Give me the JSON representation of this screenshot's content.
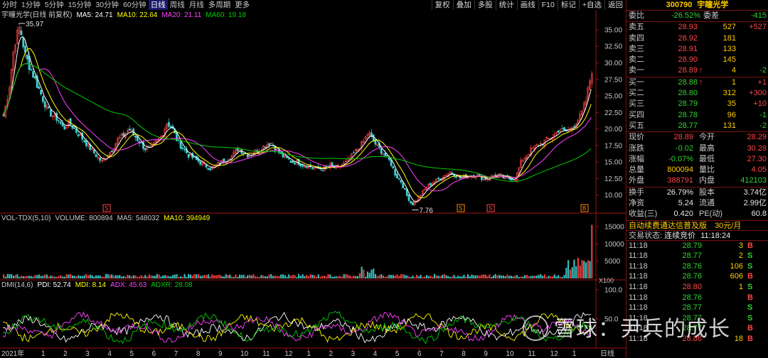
{
  "toolbar": {
    "periods": [
      "分时",
      "1分钟",
      "5分钟",
      "15分钟",
      "30分钟",
      "60分钟",
      "日线",
      "周线",
      "月线",
      "多周期",
      "更多"
    ],
    "active_period": "日线",
    "buttons": [
      "复权",
      "叠加",
      "多股",
      "统计",
      "画线",
      "F10",
      "标记",
      "+自选",
      "返回"
    ]
  },
  "main_legend": {
    "title": "宇瞳光学(日线 前复权)",
    "ma5": "MA5: 24.71",
    "ma10": "MA10: 22.64",
    "ma20": "MA20: 21.11",
    "ma60": "MA60: 19.18"
  },
  "vol_legend": {
    "title": "VOL-TDX(5,10)",
    "volume": "VOLUME: 800894",
    "ma5": "MA5: 548032",
    "ma10": "MA10: 394949",
    "unit": "X100"
  },
  "dmi_legend": {
    "title": "DMI(14,6)",
    "pdi": "PDI: 52.74",
    "mdi": "MDI: 8.14",
    "adx": "ADX: 45.63",
    "adxr": "ADXR: 28.08"
  },
  "annotations": {
    "high": "35.97",
    "low": "7.76",
    "markers": [
      "S",
      "S",
      "S",
      "B"
    ]
  },
  "x_axis": {
    "year_label": "2021年",
    "month_labels": [
      "1",
      "2",
      "3",
      "4",
      "5",
      "6",
      "7",
      "8",
      "9",
      "10",
      "11",
      "12",
      "1",
      "2",
      "3",
      "4",
      "5",
      "6",
      "7",
      "8",
      "9",
      "10",
      "11",
      "12",
      "1"
    ],
    "tail_label": "日线"
  },
  "colors": {
    "up": "#ff4545",
    "down": "#40d0d0",
    "ma5": "#ffffff",
    "ma10": "#ffff00",
    "ma20": "#ff40ff",
    "ma60": "#00cc00",
    "axis": "#a01010"
  },
  "chart_data": [
    {
      "type": "line",
      "name": "price",
      "ylim": [
        7.5,
        36.5
      ],
      "yticks": [
        "10.00",
        "12.50",
        "15.00",
        "17.50",
        "20.00",
        "22.50",
        "25.00",
        "27.50",
        "30.00",
        "32.50",
        "35.00"
      ],
      "ytick_values": [
        10,
        12.5,
        15,
        17.5,
        20,
        22.5,
        25,
        27.5,
        30,
        32.5,
        35
      ],
      "close": [
        22,
        26,
        33,
        35.5,
        31,
        29,
        27,
        25,
        23,
        22,
        21.5,
        20,
        21,
        20,
        19,
        18,
        17,
        16,
        15,
        16,
        17,
        18.5,
        19,
        20,
        19,
        18,
        17,
        17,
        18,
        19,
        21,
        20,
        18,
        17,
        16,
        15.5,
        15,
        14.5,
        14,
        14.5,
        15,
        15.5,
        16,
        17,
        16.5,
        16,
        16.5,
        17,
        17.5,
        18,
        17,
        16,
        15.5,
        15,
        15,
        14.5,
        14.5,
        14,
        14,
        14,
        14.5,
        14,
        14.5,
        15,
        16,
        17,
        18,
        19.5,
        18,
        17,
        16,
        15,
        13,
        12,
        10,
        8.5,
        9.5,
        10.5,
        11.5,
        12,
        12.5,
        13,
        13.5,
        13,
        12.5,
        13,
        13,
        13,
        12.5,
        12.5,
        13,
        13,
        12.5,
        12.5,
        12.5,
        15,
        16,
        17,
        17.5,
        18,
        18.5,
        19,
        20,
        19.5,
        20,
        21,
        22,
        24.5,
        29
      ]
    },
    {
      "type": "bar",
      "name": "volume",
      "ylim": [
        0,
        16000
      ],
      "yticks": [
        "5000",
        "10000",
        "15000"
      ],
      "ytick_values": [
        5000,
        10000,
        15000
      ]
    },
    {
      "type": "line",
      "name": "dmi",
      "ylim": [
        0,
        100
      ],
      "yticks": [
        "100.0",
        "50.0"
      ],
      "ytick_values": [
        100,
        50
      ]
    }
  ],
  "quote": {
    "code": "300790",
    "name": "宇瞳光学",
    "weibi_label": "委比",
    "weibi": "-26.52%",
    "weicha_label": "委差",
    "weicha": "-415",
    "sells": [
      {
        "label": "卖五",
        "price": "28.93",
        "vol": "527",
        "chg": "+527"
      },
      {
        "label": "卖四",
        "price": "28.92",
        "vol": "181",
        "chg": ""
      },
      {
        "label": "卖三",
        "price": "28.91",
        "vol": "133",
        "chg": ""
      },
      {
        "label": "卖二",
        "price": "28.90",
        "vol": "145",
        "chg": ""
      },
      {
        "label": "卖一",
        "price": "28.89",
        "vol": "4",
        "chg": "-2",
        "arrow": "↑"
      }
    ],
    "buys": [
      {
        "label": "买一",
        "price": "28.88",
        "vol": "1",
        "chg": "+1",
        "arrow": "↑"
      },
      {
        "label": "买二",
        "price": "28.80",
        "vol": "312",
        "chg": "+300"
      },
      {
        "label": "买三",
        "price": "28.79",
        "vol": "35",
        "chg": "+10"
      },
      {
        "label": "买四",
        "price": "28.78",
        "vol": "96",
        "chg": "-1"
      },
      {
        "label": "买五",
        "price": "28.77",
        "vol": "131",
        "chg": "-2"
      }
    ],
    "stats": [
      {
        "l1": "现价",
        "v1": "28.89",
        "l2": "今开",
        "v2": "28.29",
        "c1": "red",
        "c2": "red"
      },
      {
        "l1": "涨跌",
        "v1": "-0.02",
        "l2": "最高",
        "v2": "30.28",
        "c1": "green",
        "c2": "red"
      },
      {
        "l1": "涨幅",
        "v1": "-0.07%",
        "l2": "最低",
        "v2": "27.30",
        "c1": "green",
        "c2": "red"
      },
      {
        "l1": "总量",
        "v1": "800094",
        "l2": "量比",
        "v2": "4.05",
        "c1": "yellow",
        "c2": "red"
      },
      {
        "l1": "外盘",
        "v1": "388791",
        "l2": "内盘",
        "v2": "412103",
        "c1": "red",
        "c2": "green"
      }
    ],
    "stats2": [
      {
        "l1": "换手",
        "v1": "26.79%",
        "l2": "股本",
        "v2": "3.74亿"
      },
      {
        "l1": "净资",
        "v1": "5.24",
        "l2": "流通",
        "v2": "2.99亿"
      },
      {
        "l1": "收益(三)",
        "v1": "0.420",
        "l2": "PE(动)",
        "v2": "60.8"
      }
    ],
    "ad_text": "自动续费通达信普及版",
    "ad_price": "30元/月",
    "trade_status_label": "交易状态:",
    "trade_status": "连续竞价",
    "trade_time": "11:18:24",
    "ticks": [
      {
        "t": "11:18",
        "p": "28.79",
        "v": "3",
        "s": "B"
      },
      {
        "t": "11:18",
        "p": "28.77",
        "v": "2",
        "s": "S"
      },
      {
        "t": "11:18",
        "p": "28.76",
        "v": "106",
        "s": "S"
      },
      {
        "t": "11:18",
        "p": "28.76",
        "v": "606",
        "s": "B"
      },
      {
        "t": "11:18",
        "p": "28.80",
        "v": "1",
        "s": "S"
      },
      {
        "t": "11:18",
        "p": "28.76",
        "v": "",
        "s": "B"
      },
      {
        "t": "11:18",
        "p": "28.77",
        "v": "",
        "s": "S"
      },
      {
        "t": "11:18",
        "p": "28.77",
        "v": "",
        "s": "S"
      },
      {
        "t": "11:18",
        "p": "28.77",
        "v": "",
        "s": "B"
      },
      {
        "t": "11:18",
        "p": "28.86",
        "v": "18",
        "s": "B"
      }
    ]
  },
  "watermark": "雪球：尹兵的成长"
}
